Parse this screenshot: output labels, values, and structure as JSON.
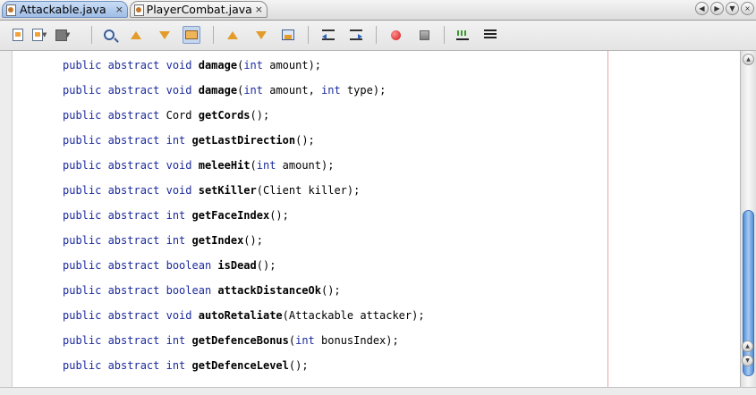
{
  "tabs": [
    {
      "label": "Attackable.java",
      "close": "×",
      "active": true
    },
    {
      "label": "PlayerCombat.java",
      "close": "×",
      "active": false
    }
  ],
  "nav": {
    "prev": "◀",
    "next": "▶",
    "menu": "▼",
    "close": "×"
  },
  "toolbar_icons": [
    "last-edit-icon",
    "back-dropdown-icon",
    "forward-disabled-icon",
    "find-selection-icon",
    "find-previous-icon",
    "find-next-icon",
    "toggle-highlight-icon",
    "previous-bookmark-icon",
    "next-bookmark-icon",
    "toggle-bookmark-icon",
    "shift-left-icon",
    "shift-right-icon",
    "start-macro-icon",
    "stop-macro-icon",
    "comment-icon",
    "uncomment-icon"
  ],
  "code_lines": [
    [
      {
        "t": "public abstract void ",
        "c": "kw"
      },
      {
        "t": "damage",
        "c": "mn"
      },
      {
        "t": "(",
        "c": ""
      },
      {
        "t": "int",
        "c": "kw"
      },
      {
        "t": " amount);",
        "c": ""
      }
    ],
    [
      {
        "t": "public abstract void ",
        "c": "kw"
      },
      {
        "t": "damage",
        "c": "mn"
      },
      {
        "t": "(",
        "c": ""
      },
      {
        "t": "int",
        "c": "kw"
      },
      {
        "t": " amount, ",
        "c": ""
      },
      {
        "t": "int",
        "c": "kw"
      },
      {
        "t": " type);",
        "c": ""
      }
    ],
    [
      {
        "t": "public abstract ",
        "c": "kw"
      },
      {
        "t": "Cord ",
        "c": ""
      },
      {
        "t": "getCords",
        "c": "mn"
      },
      {
        "t": "();",
        "c": ""
      }
    ],
    [
      {
        "t": "public abstract int ",
        "c": "kw"
      },
      {
        "t": "getLastDirection",
        "c": "mn"
      },
      {
        "t": "();",
        "c": ""
      }
    ],
    [
      {
        "t": "public abstract void ",
        "c": "kw"
      },
      {
        "t": "meleeHit",
        "c": "mn"
      },
      {
        "t": "(",
        "c": ""
      },
      {
        "t": "int",
        "c": "kw"
      },
      {
        "t": " amount);",
        "c": ""
      }
    ],
    [
      {
        "t": "public abstract void ",
        "c": "kw"
      },
      {
        "t": "setKiller",
        "c": "mn"
      },
      {
        "t": "(Client killer);",
        "c": ""
      }
    ],
    [
      {
        "t": "public abstract int ",
        "c": "kw"
      },
      {
        "t": "getFaceIndex",
        "c": "mn"
      },
      {
        "t": "();",
        "c": ""
      }
    ],
    [
      {
        "t": "public abstract int ",
        "c": "kw"
      },
      {
        "t": "getIndex",
        "c": "mn"
      },
      {
        "t": "();",
        "c": ""
      }
    ],
    [
      {
        "t": "public abstract boolean ",
        "c": "kw"
      },
      {
        "t": "isDead",
        "c": "mn"
      },
      {
        "t": "();",
        "c": ""
      }
    ],
    [
      {
        "t": "public abstract boolean ",
        "c": "kw"
      },
      {
        "t": "attackDistanceOk",
        "c": "mn"
      },
      {
        "t": "();",
        "c": ""
      }
    ],
    [
      {
        "t": "public abstract void ",
        "c": "kw"
      },
      {
        "t": "autoRetaliate",
        "c": "mn"
      },
      {
        "t": "(Attackable attacker);",
        "c": ""
      }
    ],
    [
      {
        "t": "public abstract int ",
        "c": "kw"
      },
      {
        "t": "getDefenceBonus",
        "c": "mn"
      },
      {
        "t": "(",
        "c": ""
      },
      {
        "t": "int",
        "c": "kw"
      },
      {
        "t": " bonusIndex);",
        "c": ""
      }
    ],
    [
      {
        "t": "public abstract int ",
        "c": "kw"
      },
      {
        "t": "getDefenceLevel",
        "c": "mn"
      },
      {
        "t": "();",
        "c": ""
      }
    ]
  ],
  "scroll_arrows": {
    "up": "▲",
    "down": "▼",
    "up2": "▲"
  }
}
